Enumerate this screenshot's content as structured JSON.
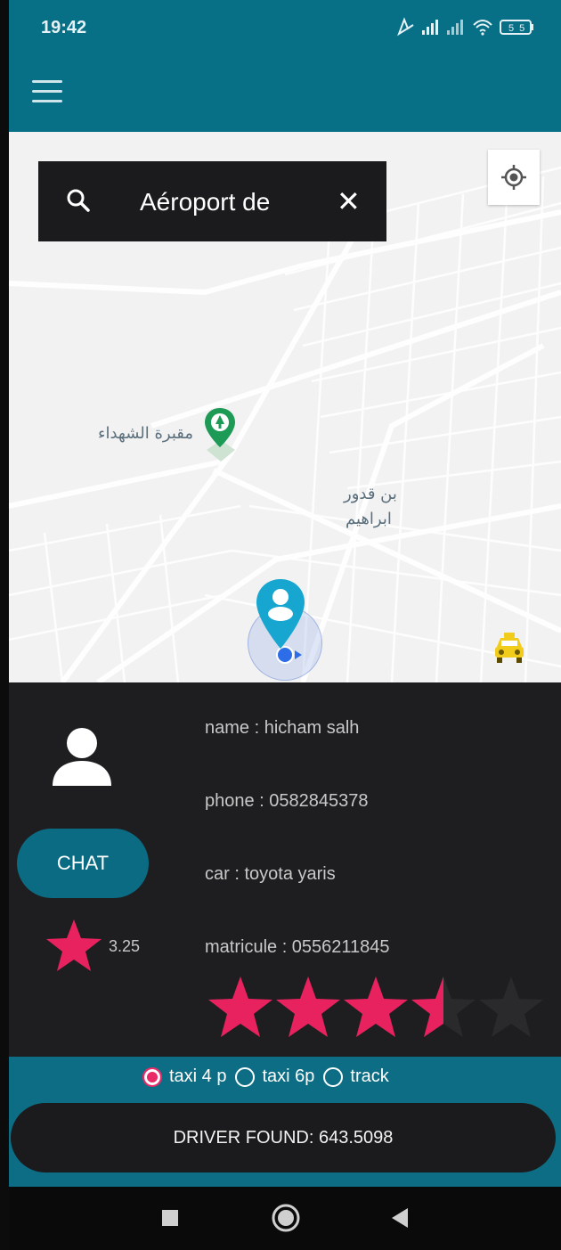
{
  "status_bar": {
    "time": "19:42",
    "battery": "55"
  },
  "search": {
    "text": "Aéroport de"
  },
  "map": {
    "labels": [
      {
        "text": "مقبرة الشهداء"
      },
      {
        "text": "بن قدور"
      },
      {
        "text": "ابراهيم"
      }
    ]
  },
  "driver": {
    "name_line": "name : hicham salh",
    "phone_line": "phone : 0582845378",
    "car_line": "car : toyota yaris",
    "matricule_line": "matricule : 0556211845",
    "rating_value": "3.25",
    "rating_stars": 3.5,
    "rating_max": 5,
    "chat_label": "CHAT"
  },
  "vehicle_options": {
    "options": [
      "taxi 4 p",
      "taxi 6p",
      "track"
    ],
    "selected": "taxi 4 p"
  },
  "status_button": {
    "label": "DRIVER FOUND: 643.5098"
  },
  "colors": {
    "app_bar": "#076f86",
    "bottom_bar": "#0c6d84",
    "panel": "#1e1e20",
    "accent_star": "#e8215f",
    "chat_button": "#0a6b82"
  },
  "icons": [
    "menu-icon",
    "search-icon",
    "close-icon",
    "my-location-icon",
    "park-pin-icon",
    "user-location-pin-icon",
    "taxi-icon",
    "person-icon",
    "star-icon",
    "stop-icon",
    "home-icon",
    "back-icon"
  ]
}
